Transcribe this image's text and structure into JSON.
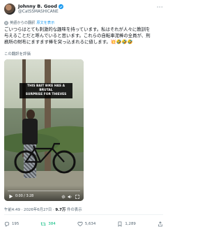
{
  "author": {
    "display_name": "Johnny B. Good",
    "handle": "@CatSSMASHICANE"
  },
  "translation": {
    "label": "英語からの翻訳",
    "link": "原文を表示"
  },
  "tweet": {
    "text": "ごいつらはとても刺激的な趣味を持っています。私はそれが人々に教訓を\n与えることだと呼んでいると思います。これらの自転車泥棒の全員が、刑\n務所の財布にますます棒を突っ込まれるに値します。💥🤣🤣🤣"
  },
  "rate_translation": "この翻訳を評価",
  "video": {
    "caption": "THIS BAIT BIKE HAS A BRUTAL\nSURPRISE FOR THIEVES",
    "time": "0:00 / 3:28",
    "progress": 0.0
  },
  "meta": {
    "time_date": "午前4:49 · 2026年6月27日 · ",
    "views_count": "9.7万",
    "views_label": " 件の表示"
  },
  "actions": {
    "replies": "195",
    "retweets": "384",
    "likes": "5,634",
    "bookmarks": "1,289"
  },
  "colors": {
    "accent": "#1d9bf0",
    "retweet": "#00ba7c"
  }
}
